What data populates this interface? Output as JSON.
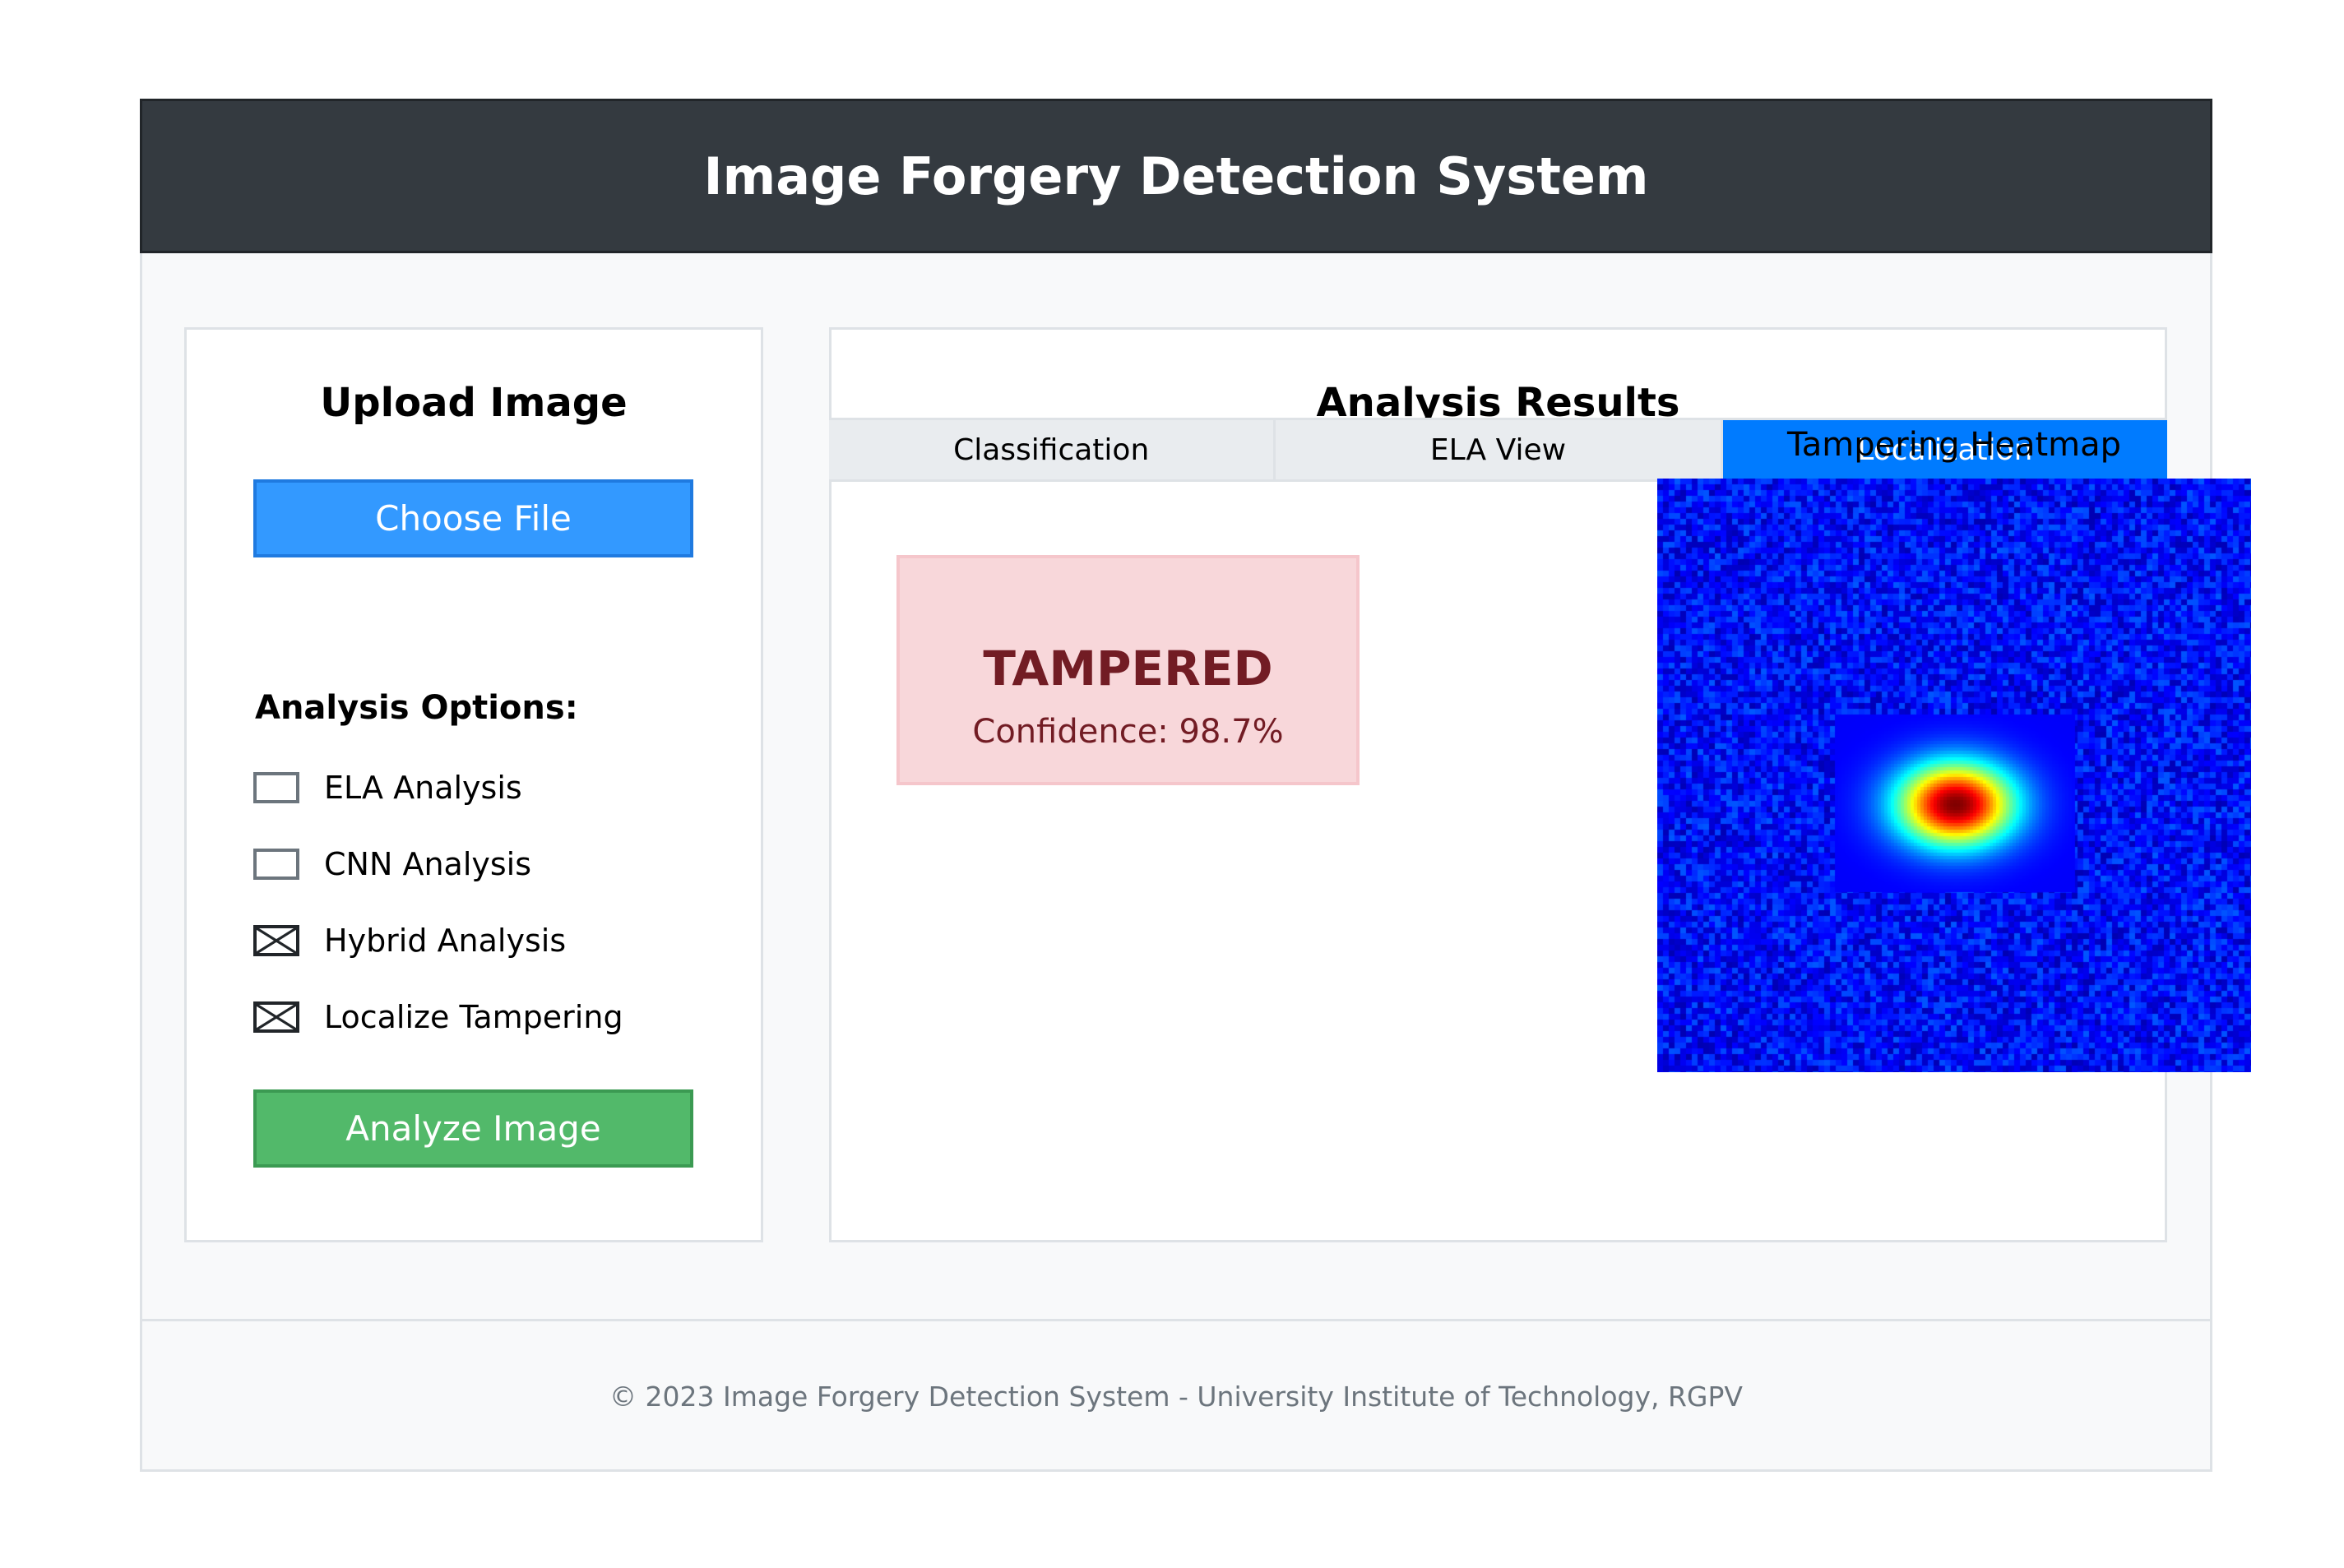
{
  "app": {
    "title": "Image Forgery Detection System"
  },
  "upload": {
    "title": "Upload Image",
    "choose_file_label": "Choose File",
    "options_label": "Analysis Options:",
    "options": [
      {
        "label": "ELA Analysis",
        "checked": false
      },
      {
        "label": "CNN Analysis",
        "checked": false
      },
      {
        "label": "Hybrid Analysis",
        "checked": true
      },
      {
        "label": "Localize Tampering",
        "checked": true
      }
    ],
    "analyze_label": "Analyze Image"
  },
  "results": {
    "title": "Analysis Results",
    "tabs": [
      {
        "label": "Classification",
        "active": false
      },
      {
        "label": "ELA View",
        "active": false
      },
      {
        "label": "Localization",
        "active": true
      }
    ],
    "verdict": "TAMPERED",
    "confidence": "Confidence: 98.7%",
    "heatmap_title": "Tampering Heatmap"
  },
  "footer": {
    "text": "© 2023 Image Forgery Detection System - University Institute of Technology, RGPV"
  },
  "colors": {
    "header_bg": "#343a40",
    "primary": "#007bff",
    "success": "#52b96a",
    "danger_bg": "#f8d7da",
    "danger_text": "#721c24"
  }
}
